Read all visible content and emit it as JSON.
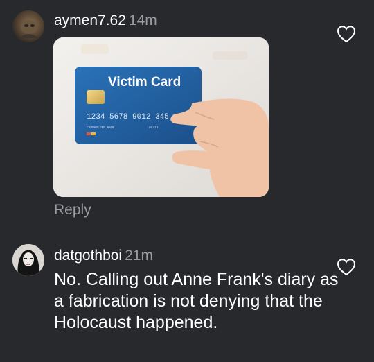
{
  "comments": [
    {
      "username": "aymen7.62",
      "time": "14m",
      "image": {
        "card_title": "Victim Card",
        "card_number": "1234 5678 9012 345",
        "card_holder_label": "CARDHOLDER NAME",
        "card_expiry": "05/19"
      },
      "reply_label": "Reply"
    },
    {
      "username": "datgothboi",
      "time": "21m",
      "text": "No. Calling out Anne Frank's diary as a fabrication is not denying that the Holocaust happened."
    }
  ],
  "icons": {
    "like": "heart-outline-icon"
  },
  "colors": {
    "background": "#27292d",
    "muted": "#9a9ca1",
    "card_blue": "#1e5f9e"
  }
}
